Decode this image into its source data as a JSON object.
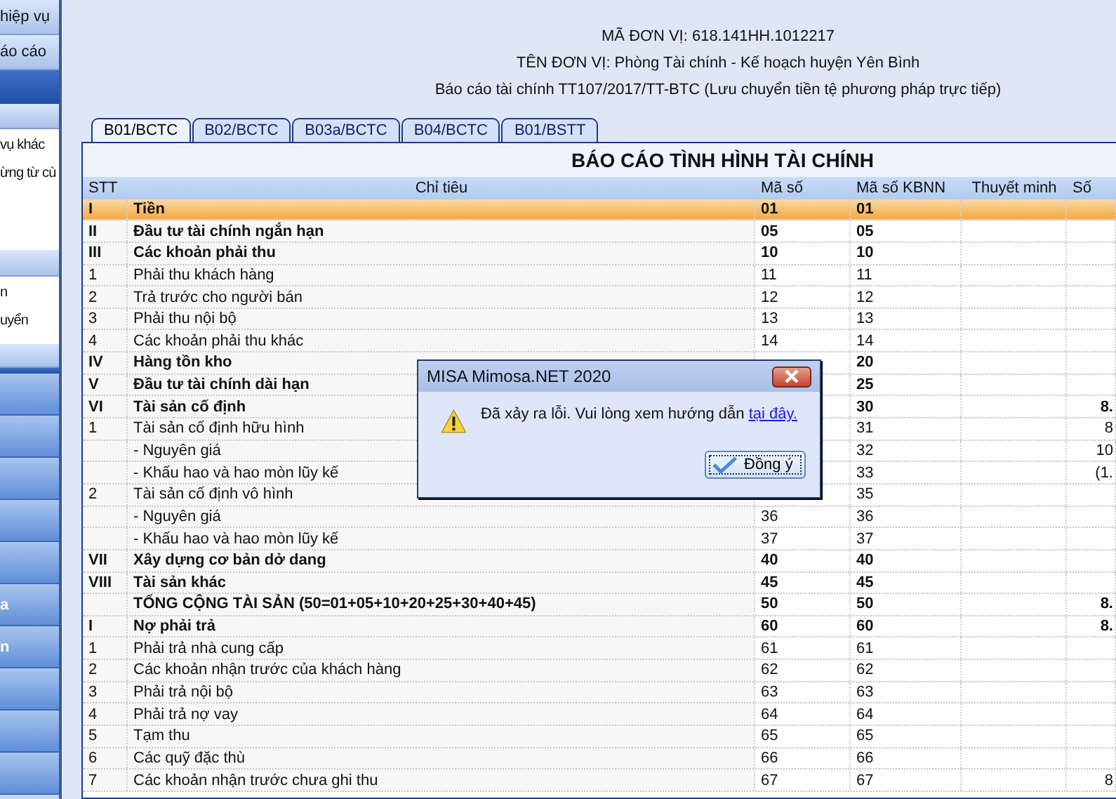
{
  "sidebar": {
    "menu": [
      "hiệp vụ",
      "áo cáo"
    ],
    "panel_1": [
      "vụ khác",
      "ừng từ cù"
    ],
    "panel_2": [
      "n",
      "uyển"
    ],
    "buttons": [
      "a",
      "n"
    ]
  },
  "header": {
    "unit_code": "MÃ ĐƠN VỊ: 618.141HH.1012217",
    "unit_name": "TÊN ĐƠN VỊ: Phòng Tài chính - Kế hoạch huyện Yên Bình",
    "report": "Báo cáo tài chính TT107/2017/TT-BTC (Lưu chuyển tiền tệ phương pháp trực tiếp)"
  },
  "tabs": [
    {
      "label": "B01/BCTC",
      "selected": true
    },
    {
      "label": "B02/BCTC",
      "selected": false
    },
    {
      "label": "B03a/BCTC",
      "selected": false
    },
    {
      "label": "B04/BCTC",
      "selected": false
    },
    {
      "label": "B01/BSTT",
      "selected": false
    }
  ],
  "table": {
    "title": "BÁO CÁO TÌNH HÌNH TÀI CHÍNH",
    "columns": [
      "STT",
      "Chỉ tiêu",
      "Mã số",
      "Mã số KBNN",
      "Thuyết minh",
      "Số"
    ],
    "rows": [
      {
        "stt": "I",
        "name": "Tiền",
        "code": "01",
        "kbnn": "01",
        "kind": "heading",
        "selected": true
      },
      {
        "stt": "II",
        "name": "Đầu tư tài chính ngắn hạn",
        "code": "05",
        "kbnn": "05",
        "kind": "heading",
        "selected": false
      },
      {
        "stt": "III",
        "name": "Các khoản phải thu",
        "code": "10",
        "kbnn": "10",
        "kind": "heading",
        "selected": false
      },
      {
        "stt": "1",
        "name": "Phải thu khách hàng",
        "code": "11",
        "kbnn": "11",
        "kind": "item",
        "selected": false
      },
      {
        "stt": "2",
        "name": "Trả trước cho người bán",
        "code": "12",
        "kbnn": "12",
        "kind": "item",
        "selected": false
      },
      {
        "stt": "3",
        "name": "Phải thu nội bộ",
        "code": "13",
        "kbnn": "13",
        "kind": "item",
        "selected": false
      },
      {
        "stt": "4",
        "name": "Các khoản phải thu khác",
        "code": "14",
        "kbnn": "14",
        "kind": "item",
        "selected": false
      },
      {
        "stt": "IV",
        "name": "Hàng tồn kho",
        "kbnn": "20",
        "kind": "heading",
        "selected": false
      },
      {
        "stt": "V",
        "name": "Đầu tư tài chính dài hạn",
        "kbnn": "25",
        "kind": "heading",
        "selected": false
      },
      {
        "stt": "VI",
        "name": "Tài sản cố định",
        "kbnn": "30",
        "value": "8.",
        "kind": "heading",
        "selected": false
      },
      {
        "stt": "1",
        "name": "Tài sản cố định hữu hình",
        "kbnn": "31",
        "value": "8",
        "kind": "item",
        "selected": false
      },
      {
        "name": "- Nguyên giá",
        "kbnn": "32",
        "value": "10",
        "kind": "item",
        "selected": false
      },
      {
        "name": "- Khấu hao và hao mòn lũy kế",
        "kbnn": "33",
        "value": "(1.",
        "kind": "item",
        "selected": false
      },
      {
        "stt": "2",
        "name": "Tài sản cố định vô hình",
        "kbnn": "35",
        "kind": "item",
        "selected": false
      },
      {
        "name": "- Nguyên giá",
        "code": "36",
        "kbnn": "36",
        "kind": "item",
        "selected": false
      },
      {
        "name": "- Khấu hao và hao mòn lũy kế",
        "code": "37",
        "kbnn": "37",
        "kind": "item",
        "selected": false
      },
      {
        "stt": "VII",
        "name": "Xây dựng cơ bản dở dang",
        "code": "40",
        "kbnn": "40",
        "kind": "heading",
        "selected": false
      },
      {
        "stt": "VIII",
        "name": "Tài sản khác",
        "code": "45",
        "kbnn": "45",
        "kind": "heading",
        "selected": false
      },
      {
        "name": "TỔNG CỘNG TÀI SẢN (50=01+05+10+20+25+30+40+45)",
        "code": "50",
        "kbnn": "50",
        "value": "8.",
        "kind": "heading",
        "selected": false
      },
      {
        "stt": "I",
        "name": "Nợ phải trả",
        "code": "60",
        "kbnn": "60",
        "value": "8.",
        "kind": "heading",
        "selected": false
      },
      {
        "stt": "1",
        "name": "Phải trả nhà cung cấp",
        "code": "61",
        "kbnn": "61",
        "kind": "item",
        "selected": false
      },
      {
        "stt": "2",
        "name": "Các khoản nhận trước của khách hàng",
        "code": "62",
        "kbnn": "62",
        "kind": "item",
        "selected": false
      },
      {
        "stt": "3",
        "name": "Phải trả nội bộ",
        "code": "63",
        "kbnn": "63",
        "kind": "item",
        "selected": false
      },
      {
        "stt": "4",
        "name": "Phải trả nợ vay",
        "code": "64",
        "kbnn": "64",
        "kind": "item",
        "selected": false
      },
      {
        "stt": "5",
        "name": "Tạm thu",
        "code": "65",
        "kbnn": "65",
        "kind": "item",
        "selected": false
      },
      {
        "stt": "6",
        "name": "Các quỹ đặc thù",
        "code": "66",
        "kbnn": "66",
        "kind": "item",
        "selected": false
      },
      {
        "stt": "7",
        "name": "Các khoản nhận trước chưa ghi thu",
        "code": "67",
        "kbnn": "67",
        "value": "8",
        "kind": "item",
        "selected": false
      }
    ]
  },
  "dialog": {
    "title": "MISA Mimosa.NET 2020",
    "message": "Đã xảy ra lỗi. Vui lòng xem hướng dẫn",
    "link": "tại đây.",
    "button": "Đồng ý"
  }
}
